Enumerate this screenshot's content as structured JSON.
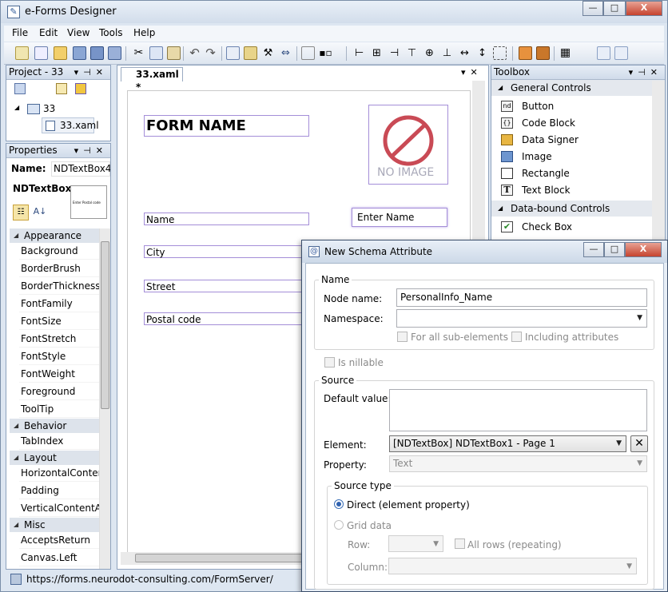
{
  "window": {
    "title": "e-Forms Designer",
    "min": "—",
    "max": "□",
    "close": "X"
  },
  "menu": [
    "File",
    "Edit",
    "View",
    "Tools",
    "Help"
  ],
  "project_panel": {
    "title": "Project - 33",
    "root": "33",
    "file": "33.xaml"
  },
  "properties_panel": {
    "title": "Properties",
    "name_label": "Name:",
    "name_value": "NDTextBox4",
    "type": "NDTextBox",
    "preview_text": "Enter Postal code",
    "categories": [
      {
        "name": "Appearance",
        "items": [
          "Background",
          "BorderBrush",
          "BorderThickness",
          "FontFamily",
          "FontSize",
          "FontStretch",
          "FontStyle",
          "FontWeight",
          "Foreground",
          "ToolTip"
        ]
      },
      {
        "name": "Behavior",
        "items": [
          "TabIndex"
        ]
      },
      {
        "name": "Layout",
        "items": [
          "HorizontalContent",
          "Padding",
          "VerticalContentAlig"
        ]
      },
      {
        "name": "Misc",
        "items": [
          "AcceptsReturn",
          "Canvas.Left"
        ]
      }
    ]
  },
  "designer": {
    "tab": "33.xaml *",
    "form_name": "FORM NAME",
    "no_image": "NO IMAGE",
    "fields": [
      "Name",
      "City",
      "Street",
      "Postal code"
    ],
    "enter_name": "Enter Name"
  },
  "toolbox": {
    "title": "Toolbox",
    "groups": [
      {
        "name": "General Controls",
        "items": [
          "Button",
          "Code Block",
          "Data Signer",
          "Image",
          "Rectangle",
          "Text Block"
        ]
      },
      {
        "name": "Data-bound Controls",
        "items": [
          "Check Box"
        ]
      }
    ]
  },
  "status": {
    "url": "https://forms.neurodot-consulting.com/FormServer/"
  },
  "dialog": {
    "title": "New Schema Attribute",
    "name_group": "Name",
    "node_name_label": "Node name:",
    "node_name_value": "PersonalInfo_Name",
    "namespace_label": "Namespace:",
    "namespace_value": "",
    "for_all_sub": "For all sub-elements",
    "including_attrs": "Including attributes",
    "is_nillable": "Is nillable",
    "source_group": "Source",
    "default_value_label": "Default value:",
    "element_label": "Element:",
    "element_value": "[NDTextBox] NDTextBox1 - Page 1",
    "property_label": "Property:",
    "property_value": "Text",
    "source_type_group": "Source type",
    "direct_label": "Direct (element property)",
    "grid_label": "Grid data",
    "row_label": "Row:",
    "all_rows_label": "All rows (repeating)",
    "column_label": "Column:"
  }
}
